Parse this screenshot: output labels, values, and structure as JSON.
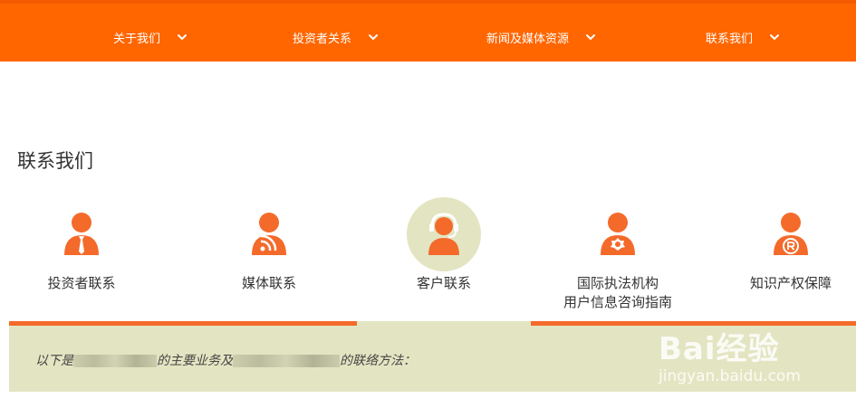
{
  "nav": {
    "items": [
      {
        "label": "关于我们"
      },
      {
        "label": "投资者关系"
      },
      {
        "label": "新闻及媒体资源"
      },
      {
        "label": "联系我们"
      }
    ]
  },
  "page": {
    "title": "联系我们"
  },
  "tabs": [
    {
      "label": "投资者联系",
      "label2": ""
    },
    {
      "label": "媒体联系",
      "label2": ""
    },
    {
      "label": "客户联系",
      "label2": ""
    },
    {
      "label": "国际执法机构",
      "label2": "用户信息咨询指南"
    },
    {
      "label": "知识产权保障",
      "label2": ""
    }
  ],
  "panel": {
    "text_1": "以下是",
    "text_2": "的主要业务及",
    "text_3": "的联络方法："
  },
  "watermark": {
    "logo": "Bai经验",
    "sub": "jingyan.baidu.com"
  },
  "colors": {
    "nav": "#ff6600",
    "accent": "#f46a2a",
    "panel": "#e3e5c2"
  },
  "icons": [
    "chevron-down-icon",
    "investor-person-icon",
    "media-rss-person-icon",
    "customer-headset-person-icon",
    "police-badge-person-icon",
    "trademark-person-icon"
  ]
}
